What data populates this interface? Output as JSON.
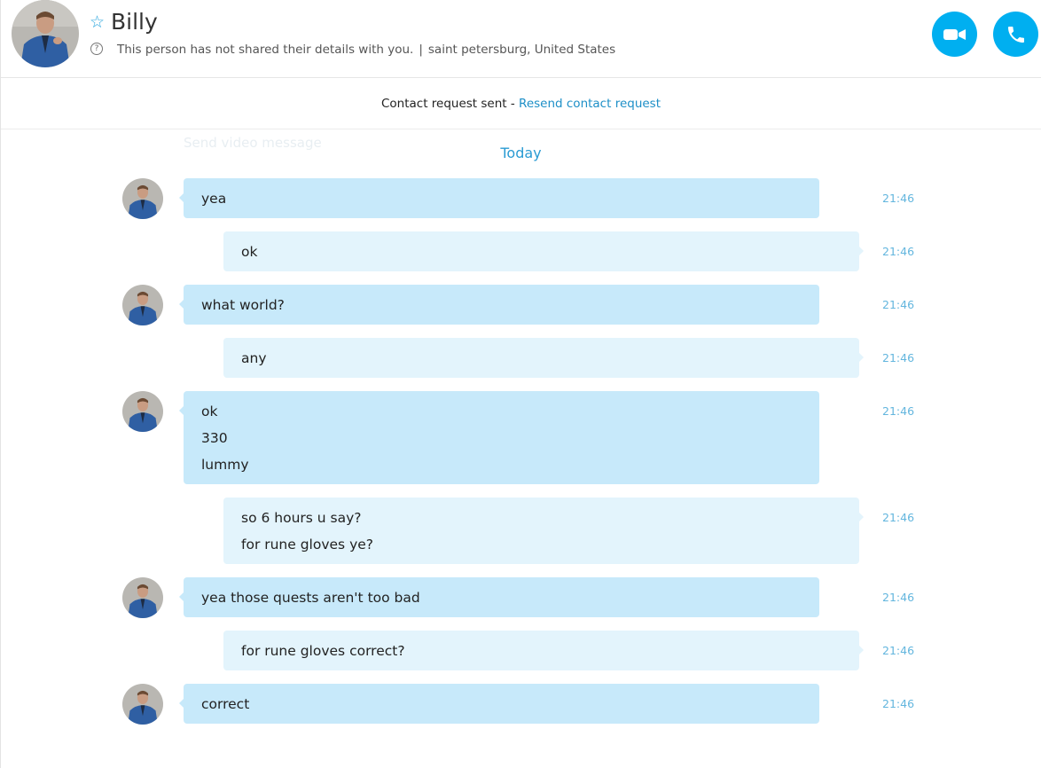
{
  "contact": {
    "name": "Billy",
    "status_text": "This person has not shared their details with you.",
    "location": "saint petersburg, United States"
  },
  "banner": {
    "text": "Contact request sent - ",
    "link": "Resend contact request"
  },
  "ghost_text": "Send video message",
  "day_label": "Today",
  "messages": [
    {
      "direction": "in",
      "lines": [
        "yea"
      ],
      "time": "21:46"
    },
    {
      "direction": "out",
      "lines": [
        "ok"
      ],
      "time": "21:46"
    },
    {
      "direction": "in",
      "lines": [
        "what world?"
      ],
      "time": "21:46"
    },
    {
      "direction": "out",
      "lines": [
        "any"
      ],
      "time": "21:46"
    },
    {
      "direction": "in",
      "lines": [
        "ok",
        "330",
        "lummy"
      ],
      "time": "21:46"
    },
    {
      "direction": "out",
      "lines": [
        "so 6 hours u say?",
        "for rune gloves ye?"
      ],
      "time": "21:46"
    },
    {
      "direction": "in",
      "lines": [
        "yea those quests aren't too bad"
      ],
      "time": "21:46"
    },
    {
      "direction": "out",
      "lines": [
        "for rune gloves correct?"
      ],
      "time": "21:46"
    },
    {
      "direction": "in",
      "lines": [
        "correct"
      ],
      "time": "21:46"
    }
  ],
  "colors": {
    "accent": "#00aff0",
    "incoming_bubble": "#c7e9fa",
    "outgoing_bubble": "#e3f4fc",
    "link": "#1d8fc7",
    "timestamp": "#63b6de"
  },
  "icons": {
    "favorite": "star-outline-icon",
    "info": "question-circle-icon",
    "video_call": "video-camera-icon",
    "audio_call": "phone-icon"
  }
}
